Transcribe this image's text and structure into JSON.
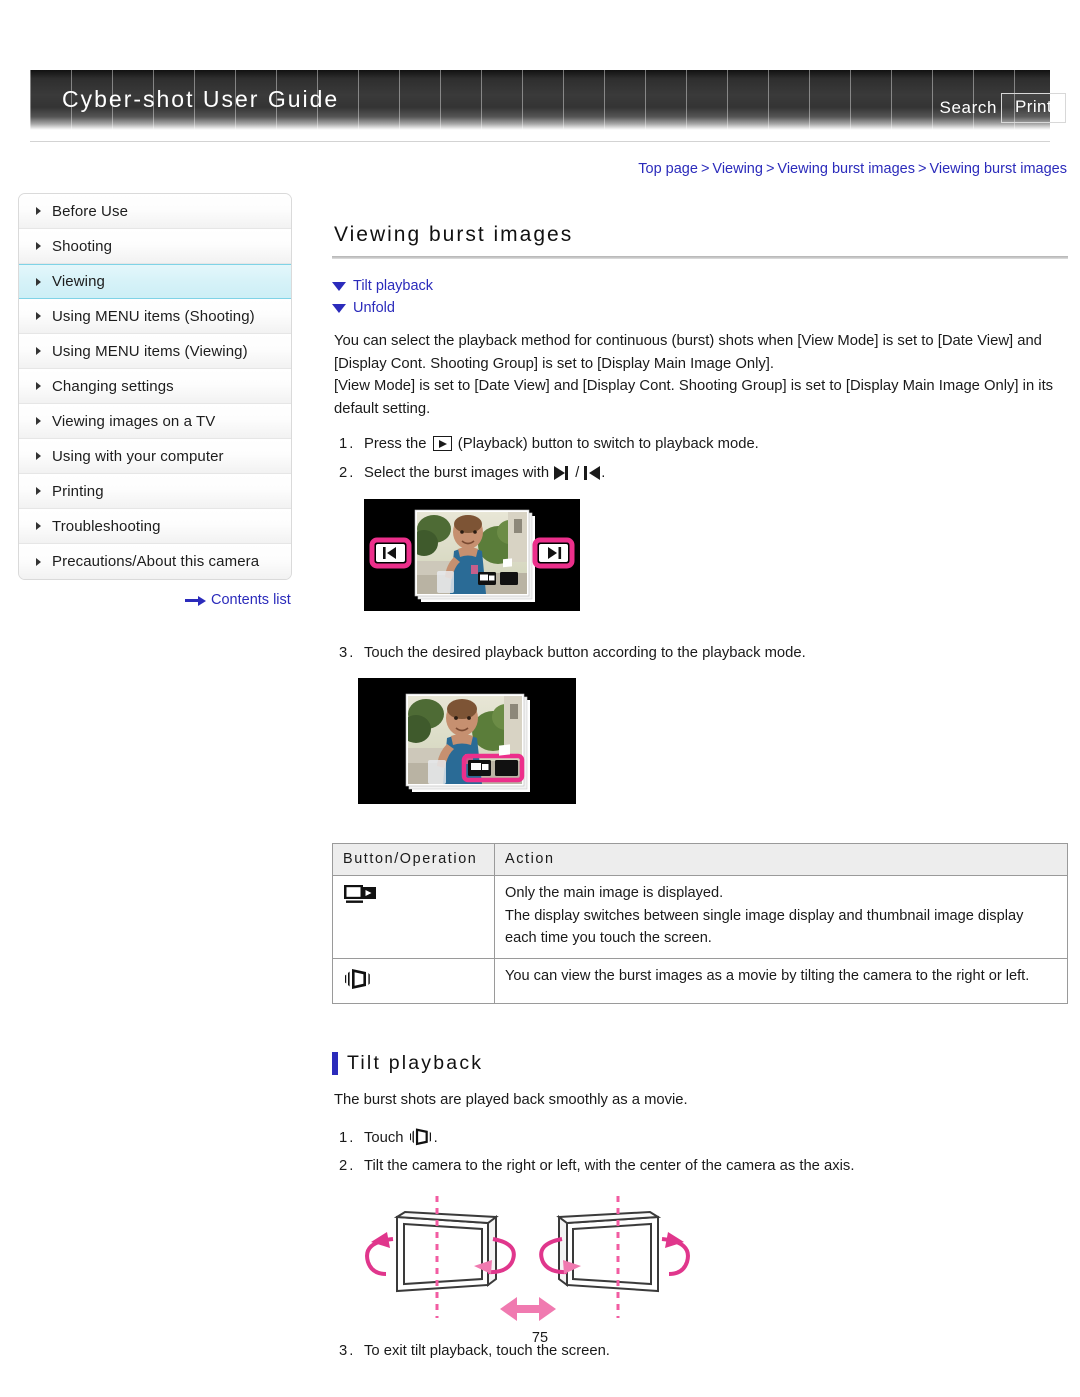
{
  "header": {
    "title": "Cyber-shot User Guide",
    "search_label": "Search",
    "print_label": "Print"
  },
  "breadcrumb": {
    "items": [
      "Top page",
      "Viewing",
      "Viewing burst images",
      "Viewing burst images"
    ],
    "separator": ">"
  },
  "sidebar": {
    "items": [
      {
        "label": "Before Use",
        "active": false
      },
      {
        "label": "Shooting",
        "active": false
      },
      {
        "label": "Viewing",
        "active": true
      },
      {
        "label": "Using MENU items (Shooting)",
        "active": false
      },
      {
        "label": "Using MENU items (Viewing)",
        "active": false
      },
      {
        "label": "Changing settings",
        "active": false
      },
      {
        "label": "Viewing images on a TV",
        "active": false
      },
      {
        "label": "Using with your computer",
        "active": false
      },
      {
        "label": "Printing",
        "active": false
      },
      {
        "label": "Troubleshooting",
        "active": false
      },
      {
        "label": "Precautions/About this camera",
        "active": false
      }
    ],
    "contents_list_label": "Contents list"
  },
  "main": {
    "page_title": "Viewing burst images",
    "anchors": [
      {
        "label": "Tilt playback"
      },
      {
        "label": "Unfold"
      }
    ],
    "intro_p1": "You can select the playback method for continuous (burst) shots when [View Mode] is set to [Date View] and [Display Cont. Shooting Group] is set to [Display Main Image Only].",
    "intro_p2": "[View Mode] is set to [Date View] and [Display Cont. Shooting Group] is set to [Display Main Image Only] in its default setting.",
    "steps": [
      {
        "num": "1.",
        "pre": "Press the",
        "icon": "playback-button-icon",
        "post": "(Playback) button to switch to playback mode."
      },
      {
        "num": "2.",
        "pre": "Select the burst images with",
        "icon": "next-prev-icon",
        "post": "."
      },
      {
        "num": "3.",
        "pre": "Touch the desired playback button according to the playback mode.",
        "icon": "",
        "post": ""
      }
    ],
    "figure1_caption": "Camera screen showing burst image with previous and next buttons highlighted",
    "figure2_caption": "Camera screen showing burst image with playback mode buttons highlighted",
    "table": {
      "headers": [
        "Button/Operation",
        "Action"
      ],
      "rows": [
        {
          "icon": "single-thumbnail-switch-icon",
          "action_lines": [
            "Only the main image is displayed.",
            "The display switches between single image display and thumbnail image display each time you touch the screen."
          ]
        },
        {
          "icon": "tilt-playback-icon",
          "action_lines": [
            "You can view the burst images as a movie by tilting the camera to the right or left."
          ]
        }
      ]
    },
    "section": {
      "title": "Tilt playback",
      "intro": "The burst shots are played back smoothly as a movie.",
      "steps": [
        {
          "num": "1.",
          "pre": "Touch",
          "icon": "tilt-playback-icon",
          "post": "."
        },
        {
          "num": "2.",
          "pre": "Tilt the camera to the right or left, with the center of the camera as the axis.",
          "icon": "",
          "post": ""
        },
        {
          "num": "3.",
          "pre": "To exit tilt playback, touch the screen.",
          "icon": "",
          "post": ""
        }
      ],
      "diagram_caption": "Two cameras tilting left and right around a vertical center axis"
    }
  },
  "footer": {
    "page_number": "75"
  },
  "colors": {
    "link": "#2b2bbb",
    "accent_bar": "#2b2bbb",
    "highlight": "#d6f2f8",
    "pink": "#ec2f8b",
    "header_dark": "#2e2e2e"
  }
}
